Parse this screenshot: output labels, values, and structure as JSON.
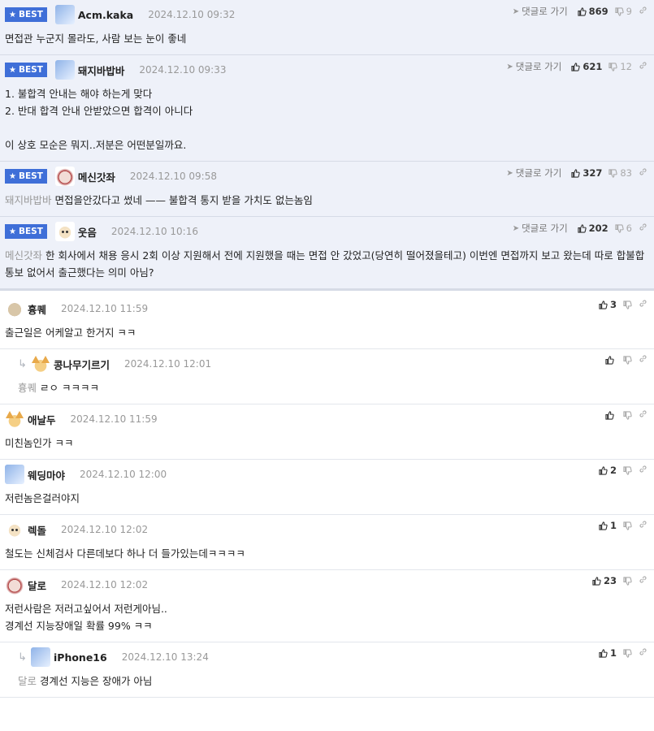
{
  "best_badge": "BEST",
  "reply_label": "댓글로 가기",
  "best_comments": [
    {
      "nick": "Acm.kaka",
      "date": "2024.12.10 09:32",
      "likes": "869",
      "dislikes": "9",
      "text": "면접관 누군지 몰라도, 사람 보는 눈이 좋네",
      "avatar": "av-blue"
    },
    {
      "nick": "돼지바밥바",
      "date": "2024.12.10 09:33",
      "likes": "621",
      "dislikes": "12",
      "text": "1. 불합격 안내는 해야 하는게 맞다\n2. 반대 합격 안내 안받았으면 합격이 아니다\n\n이 상호 모순은 뭐지..저분은 어떤분일까요.",
      "avatar": "av-blue"
    },
    {
      "nick": "메신갓좌",
      "date": "2024.12.10 09:58",
      "likes": "327",
      "dislikes": "83",
      "mention": "돼지바밥바",
      "text": "면접을안갔다고 썼네 —— 불합격 통지 받을 가치도 없는놈임",
      "avatar": "av-red"
    },
    {
      "nick": "웃음",
      "date": "2024.12.10 10:16",
      "likes": "202",
      "dislikes": "6",
      "mention": "메신갓좌",
      "text": "한 회사에서 채용 응시 2회 이상 지원해서 전에 지원했을 때는 면접 안 갔었고(당연히 떨어졌을테고) 이번엔 면접까지 보고 왔는데 따로 합불합 통보 없어서 출근했다는 의미 아님?",
      "avatar": "av-dog"
    }
  ],
  "comments": [
    {
      "nick": "흉퀘",
      "date": "2024.12.10 11:59",
      "likes": "3",
      "text": "출근일은 어케알고 한거지 ㅋㅋ",
      "avatar": "av-tan",
      "reply": false
    },
    {
      "nick": "콩나무기르기",
      "date": "2024.12.10 12:01",
      "likes": "",
      "mention": "흉퀘",
      "text": "ㄹㅇ ㅋㅋㅋㅋ",
      "avatar": "av-fox",
      "reply": true
    },
    {
      "nick": "애날두",
      "date": "2024.12.10 11:59",
      "likes": "",
      "text": "미친놈인가 ㅋㅋ",
      "avatar": "av-fox",
      "reply": false
    },
    {
      "nick": "웨딩마야",
      "date": "2024.12.10 12:00",
      "likes": "2",
      "text": "저런놈은걸러야지",
      "avatar": "av-blue",
      "reply": false
    },
    {
      "nick": "렉돌",
      "date": "2024.12.10 12:02",
      "likes": "1",
      "text": "철도는 신체검사 다른데보다 하나 더 들가있는데ㅋㅋㅋㅋ",
      "avatar": "av-dog",
      "reply": false
    },
    {
      "nick": "달로",
      "date": "2024.12.10 12:02",
      "likes": "23",
      "text": "저런사람은 저러고싶어서 저런게아님..\n경계선 지능장애일 확률 99% ㅋㅋ",
      "avatar": "av-red",
      "reply": false
    },
    {
      "nick": "iPhone16",
      "date": "2024.12.10 13:24",
      "likes": "1",
      "mention": "달로",
      "text": "경계선 지능은 장애가 아님",
      "avatar": "av-blue",
      "reply": true
    }
  ]
}
